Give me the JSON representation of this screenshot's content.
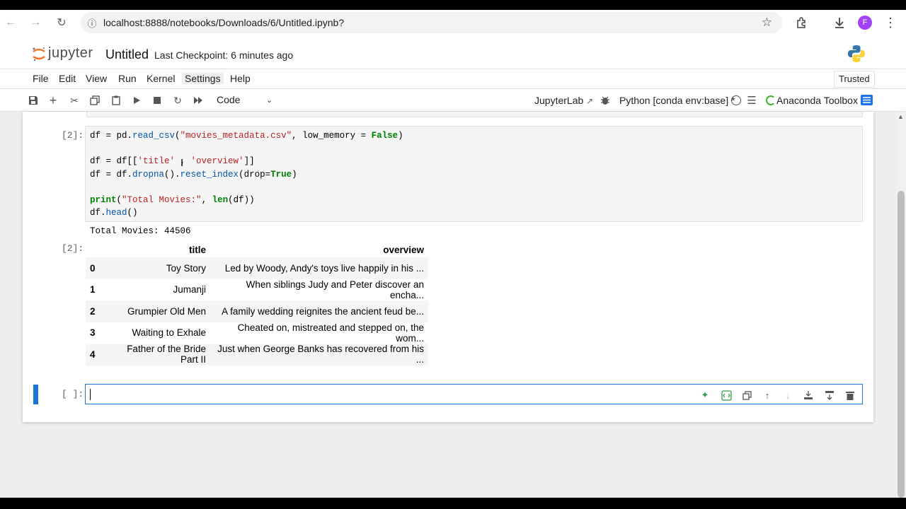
{
  "browser": {
    "url": "localhost:8888/notebooks/Downloads/6/Untitled.ipynb?",
    "profile_initial": "F"
  },
  "header": {
    "logo_text": "jupyter",
    "notebook_title": "Untitled",
    "checkpoint": "Last Checkpoint: 6 minutes ago"
  },
  "menu": {
    "items": [
      "File",
      "Edit",
      "View",
      "Run",
      "Kernel",
      "Settings",
      "Help"
    ],
    "trusted": "Trusted"
  },
  "toolbar": {
    "cell_type": "Code",
    "jupyterlab_link": "JupyterLab",
    "kernel_name": "Python [conda env:base] *",
    "anaconda": "Anaconda Toolbox"
  },
  "cells": {
    "cell1_prompt": "[2]:",
    "cell1_code": [
      "df = pd.read_csv(\"movies_metadata.csv\", low_memory = False)",
      "",
      "df = df[['title' , 'overview']]",
      "df = df.dropna().reset_index(drop=True)",
      "",
      "print(\"Total Movies:\", len(df))",
      "df.head()"
    ],
    "stdout": "Total Movies: 44506",
    "output_prompt": "[2]:",
    "table": {
      "columns": [
        "",
        "title",
        "overview"
      ],
      "rows": [
        {
          "idx": "0",
          "title": "Toy Story",
          "overview": "Led by Woody, Andy's toys live happily in his ..."
        },
        {
          "idx": "1",
          "title": "Jumanji",
          "overview": "When siblings Judy and Peter discover an encha..."
        },
        {
          "idx": "2",
          "title": "Grumpier Old Men",
          "overview": "A family wedding reignites the ancient feud be..."
        },
        {
          "idx": "3",
          "title": "Waiting to Exhale",
          "overview": "Cheated on, mistreated and stepped on, the wom..."
        },
        {
          "idx": "4",
          "title": "Father of the Bride Part II",
          "overview": "Just when George Banks has recovered from his ..."
        }
      ]
    },
    "cell2_prompt": "[ ]:"
  },
  "colors": {
    "accent": "#1976d2",
    "string": "#ba2121",
    "keyword": "#008000"
  }
}
